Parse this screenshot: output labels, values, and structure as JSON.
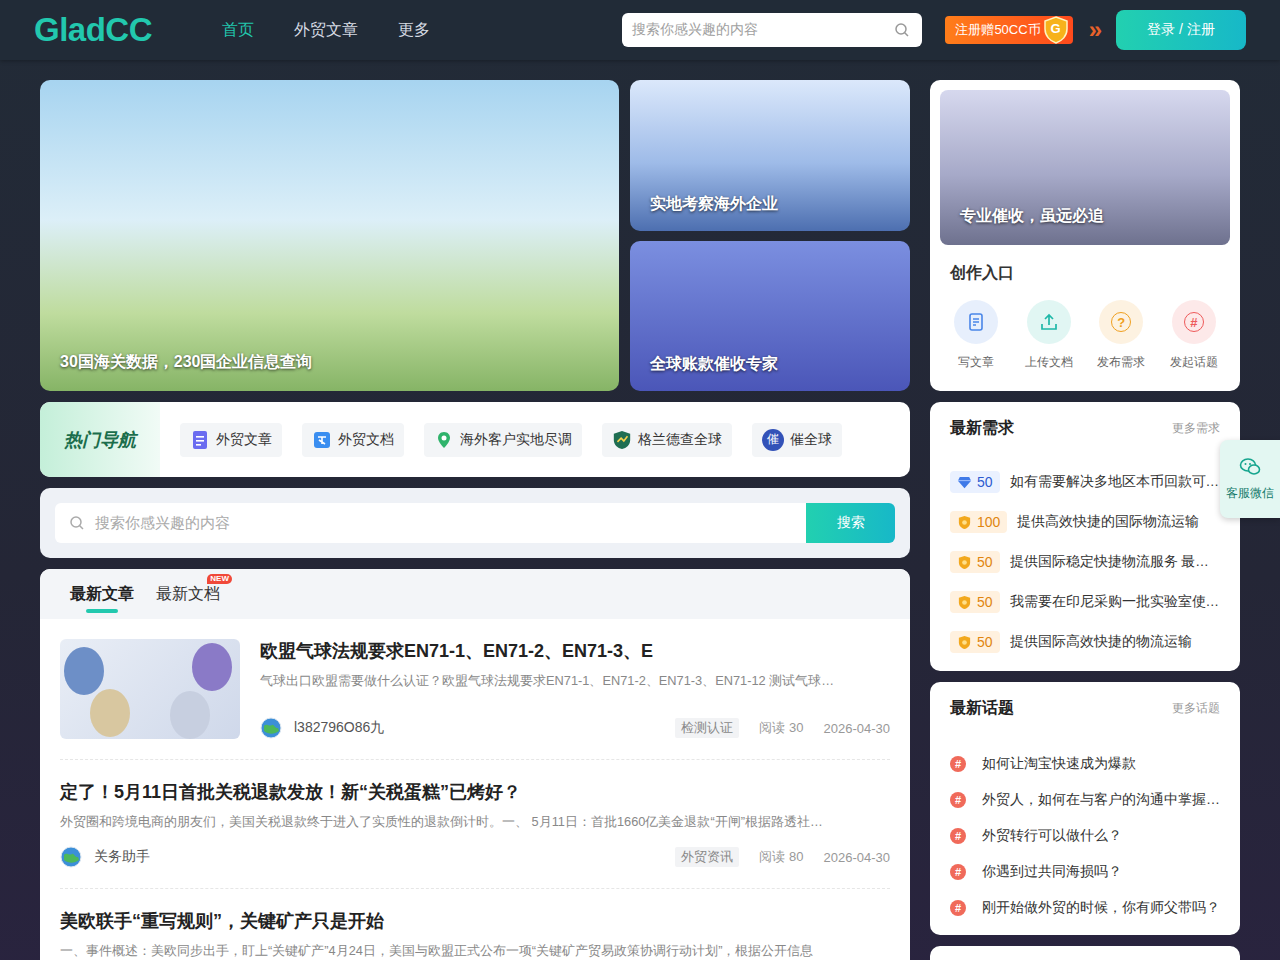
{
  "header": {
    "logo": "GladCC",
    "nav": [
      {
        "label": "首页",
        "selected": true
      },
      {
        "label": "外贸文章",
        "selected": false
      },
      {
        "label": "更多",
        "selected": false
      }
    ],
    "search_placeholder": "搜索你感兴趣的内容",
    "promo": "注册赠50CC币",
    "promo_icon": "G",
    "arrows": "»",
    "login": "登录 / 注册"
  },
  "banners": {
    "main": {
      "caption": "30国海关数据，230国企业信息查询"
    },
    "side": [
      {
        "caption": "实地考察海外企业"
      },
      {
        "caption": "全球账款催收专家"
      }
    ]
  },
  "right_banner": {
    "caption": "专业催收，虽远必追"
  },
  "create": {
    "title": "创作入口",
    "items": [
      {
        "label": "写文章",
        "glyph": "",
        "color": "#4a86e8"
      },
      {
        "label": "上传文档",
        "glyph": "",
        "color": "#1fb8a8"
      },
      {
        "label": "发布需求",
        "glyph": "?",
        "color": "#f0a020"
      },
      {
        "label": "发起话题",
        "glyph": "#",
        "color": "#ee5a5a"
      }
    ]
  },
  "hot_nav": {
    "title": "热门导航",
    "items": [
      {
        "label": "外贸文章",
        "glyph": ""
      },
      {
        "label": "外贸文档",
        "glyph": ""
      },
      {
        "label": "海外客户实地尽调",
        "glyph": ""
      },
      {
        "label": "格兰德查全球",
        "glyph": ""
      },
      {
        "label": "催全球",
        "glyph": "催"
      }
    ]
  },
  "search": {
    "placeholder": "搜索你感兴趣的内容",
    "button": "搜索"
  },
  "articles": {
    "tabs": [
      {
        "label": "最新文章",
        "selected": true,
        "badge": ""
      },
      {
        "label": "最新文档",
        "selected": false,
        "badge": "NEW"
      }
    ],
    "items": [
      {
        "kind": "image",
        "title": "欧盟气球法规要求EN71-1、EN71-2、EN71-3、E",
        "summary": "气球出口欧盟需要做什么认证？欧盟气球法规要求EN71-1、EN71-2、EN71-3、EN71-12 测试气球…",
        "author": "l382796O86九",
        "tag": "检测认证",
        "reads": "阅读 30",
        "date": "2026-04-30"
      },
      {
        "kind": "text",
        "title": "定了！5月11日首批关税退款发放！新“关税蛋糕”已烤好？",
        "summary": "外贸圈和跨境电商的朋友们，美国关税退款终于进入了实质性的退款倒计时。一、 5月11日：首批1660亿美金退款“开闸”根据路透社…",
        "author": "关务助手",
        "tag": "外贸资讯",
        "reads": "阅读 80",
        "date": "2026-04-30"
      },
      {
        "kind": "text",
        "title": "美欧联手“重写规则”，关键矿产只是开始",
        "summary": "一、事件概述：美欧同步出手，盯上“关键矿产”4月24日，美国与欧盟正式公布一项“关键矿产贸易政策协调行动计划”，根据公开信息",
        "author": "",
        "tag": "",
        "reads": "",
        "date": ""
      }
    ]
  },
  "needs": {
    "title": "最新需求",
    "more": "更多需求",
    "items": [
      {
        "kind": "diamond",
        "points": "50",
        "text": "如有需要解决多地区本币回款可…"
      },
      {
        "kind": "coin",
        "points": "100",
        "text": "提供高效快捷的国际物流运输"
      },
      {
        "kind": "coin",
        "points": "50",
        "text": "提供国际稳定快捷物流服务 最…"
      },
      {
        "kind": "coin",
        "points": "50",
        "text": "我需要在印尼采购一批实验室使…"
      },
      {
        "kind": "coin",
        "points": "50",
        "text": "提供国际高效快捷的物流运输"
      }
    ]
  },
  "topics": {
    "title": "最新话题",
    "more": "更多话题",
    "icon": "#",
    "items": [
      "如何让淘宝快速成为爆款",
      "外贸人，如何在与客户的沟通中掌握…",
      "外贸转行可以做什么？",
      "你遇到过共同海损吗？",
      "刚开始做外贸的时候，你有师父带吗？"
    ]
  },
  "service": {
    "label": "客服微信"
  }
}
